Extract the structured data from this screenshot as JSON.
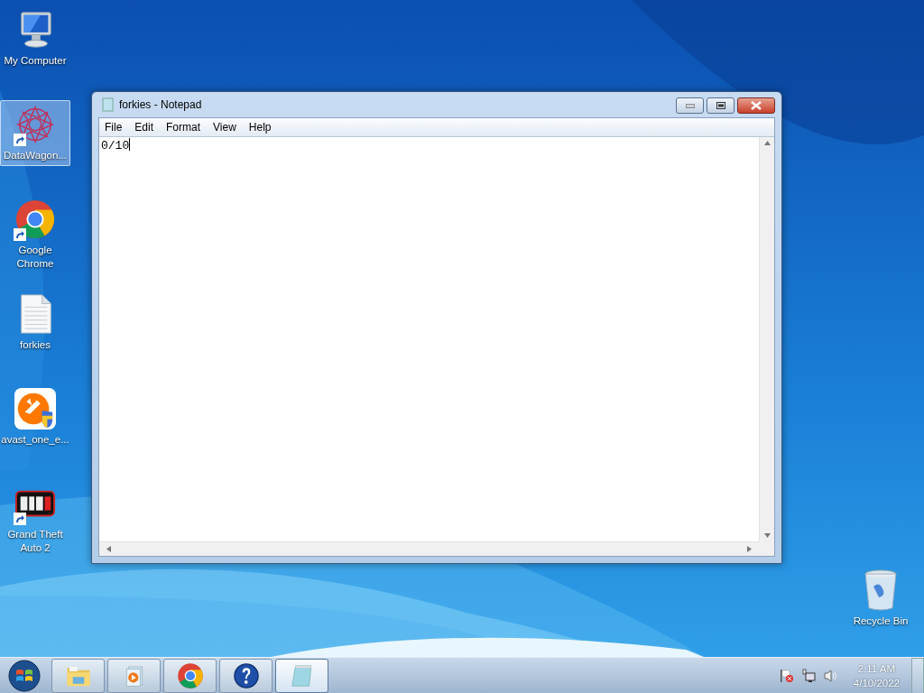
{
  "desktop_icons": [
    {
      "label": "My Computer",
      "kind": "computer",
      "selected": false,
      "shortcut": false
    },
    {
      "label": "DataWagon...",
      "kind": "star",
      "selected": true,
      "shortcut": true
    },
    {
      "label": "Google Chrome",
      "kind": "chrome",
      "selected": false,
      "shortcut": true
    },
    {
      "label": "forkies",
      "kind": "textfile",
      "selected": false,
      "shortcut": false
    },
    {
      "label": "avast_one_e...",
      "kind": "avast",
      "selected": false,
      "shortcut": false
    },
    {
      "label": "Grand Theft Auto 2",
      "kind": "game",
      "selected": false,
      "shortcut": true
    }
  ],
  "recycle_bin": {
    "label": "Recycle Bin"
  },
  "window": {
    "title": "forkies - Notepad",
    "menu": [
      "File",
      "Edit",
      "Format",
      "View",
      "Help"
    ],
    "text": "0/10"
  },
  "taskbar": {
    "buttons": [
      {
        "kind": "explorer",
        "selected": false
      },
      {
        "kind": "media",
        "selected": false
      },
      {
        "kind": "chrome",
        "selected": false
      },
      {
        "kind": "help",
        "selected": false
      },
      {
        "kind": "notepad",
        "selected": true
      }
    ],
    "clock": {
      "time": "2:11 AM",
      "date": "4/10/2022"
    }
  }
}
